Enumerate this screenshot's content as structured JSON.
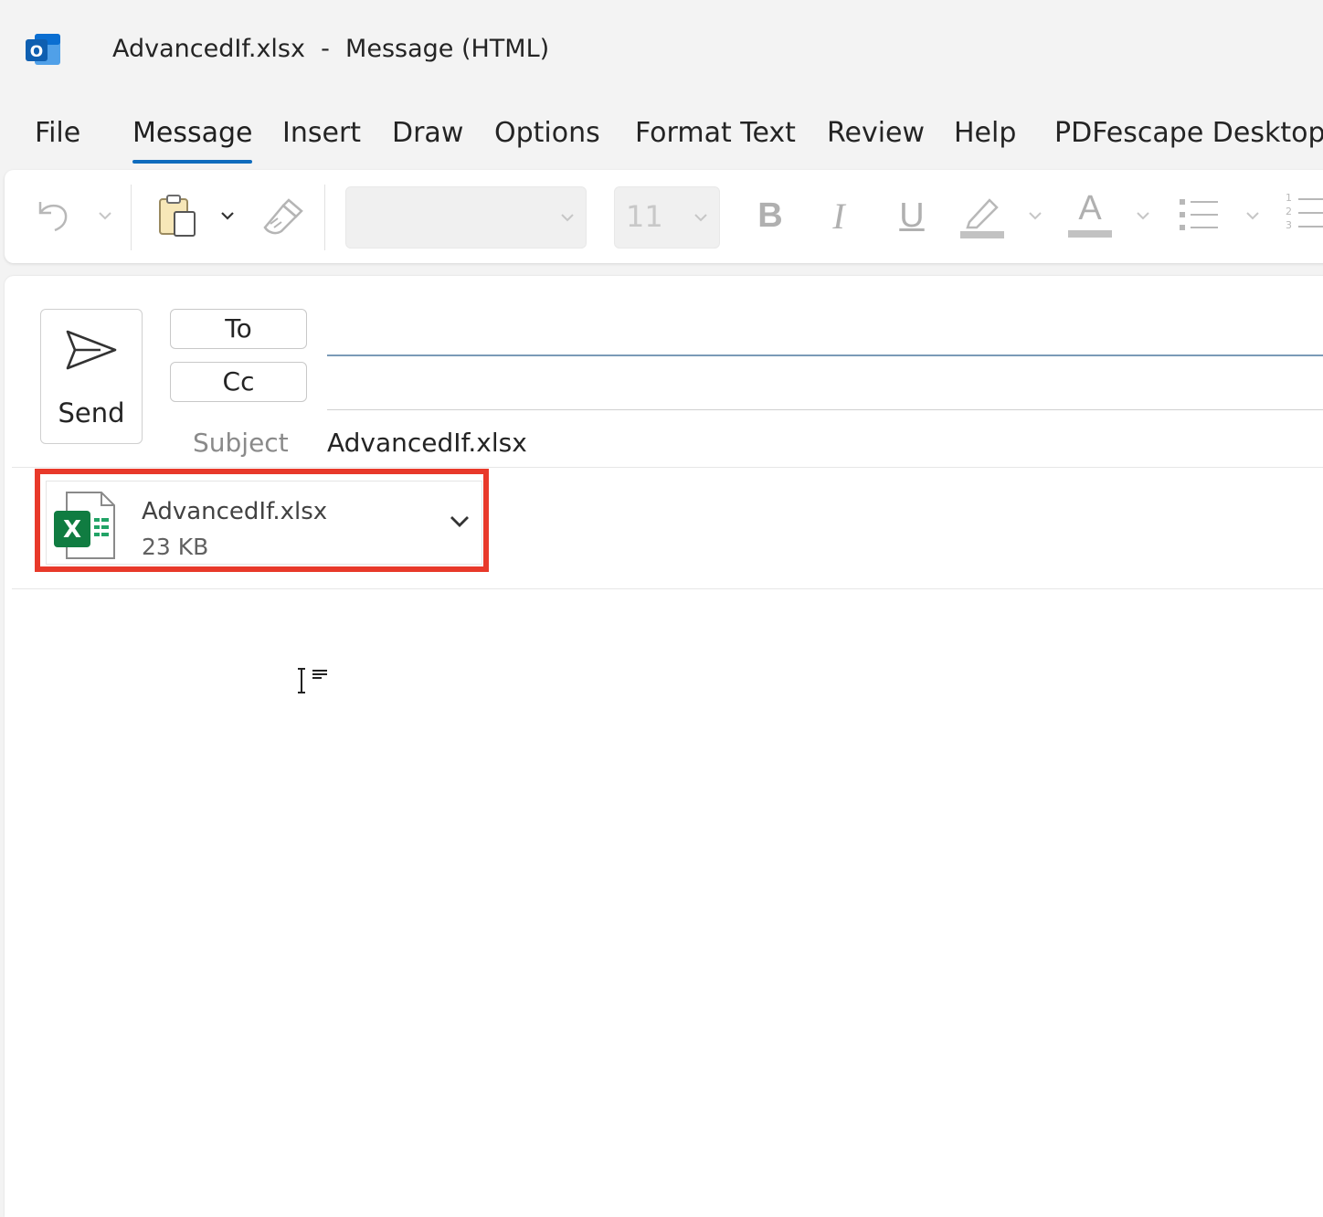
{
  "window": {
    "title": "AdvancedIf.xlsx  -  Message (HTML)",
    "app_icon": "outlook-icon",
    "accent": "#0f6cbd"
  },
  "tabs": [
    {
      "label": "File",
      "active": false
    },
    {
      "label": "Message",
      "active": true
    },
    {
      "label": "Insert",
      "active": false
    },
    {
      "label": "Draw",
      "active": false
    },
    {
      "label": "Options",
      "active": false
    },
    {
      "label": "Format Text",
      "active": false
    },
    {
      "label": "Review",
      "active": false
    },
    {
      "label": "Help",
      "active": false
    },
    {
      "label": "PDFescape Desktop",
      "active": false
    }
  ],
  "toolbar": {
    "undo_icon": "undo-icon",
    "paste_icon": "clipboard-paste-icon",
    "format_painter_icon": "format-painter-icon",
    "font_name": "",
    "font_size": "11",
    "bold_label": "B",
    "italic_label": "I",
    "underline_label": "U",
    "highlight_icon": "highlighter-icon",
    "font_color_label": "A",
    "bullets_icon": "bulleted-list-icon",
    "numbering_icon": "numbered-list-icon",
    "numbering_digits": [
      "1",
      "2",
      "3"
    ]
  },
  "compose": {
    "send_label": "Send",
    "send_icon": "send-icon",
    "to_label": "To",
    "to_value": "",
    "cc_label": "Cc",
    "cc_value": "",
    "subject_label": "Subject",
    "subject_value": "AdvancedIf.xlsx"
  },
  "attachment": {
    "name": "AdvancedIf.xlsx",
    "size": "23 KB",
    "icon": "excel-file-icon",
    "highlight_color": "#e8392a"
  }
}
